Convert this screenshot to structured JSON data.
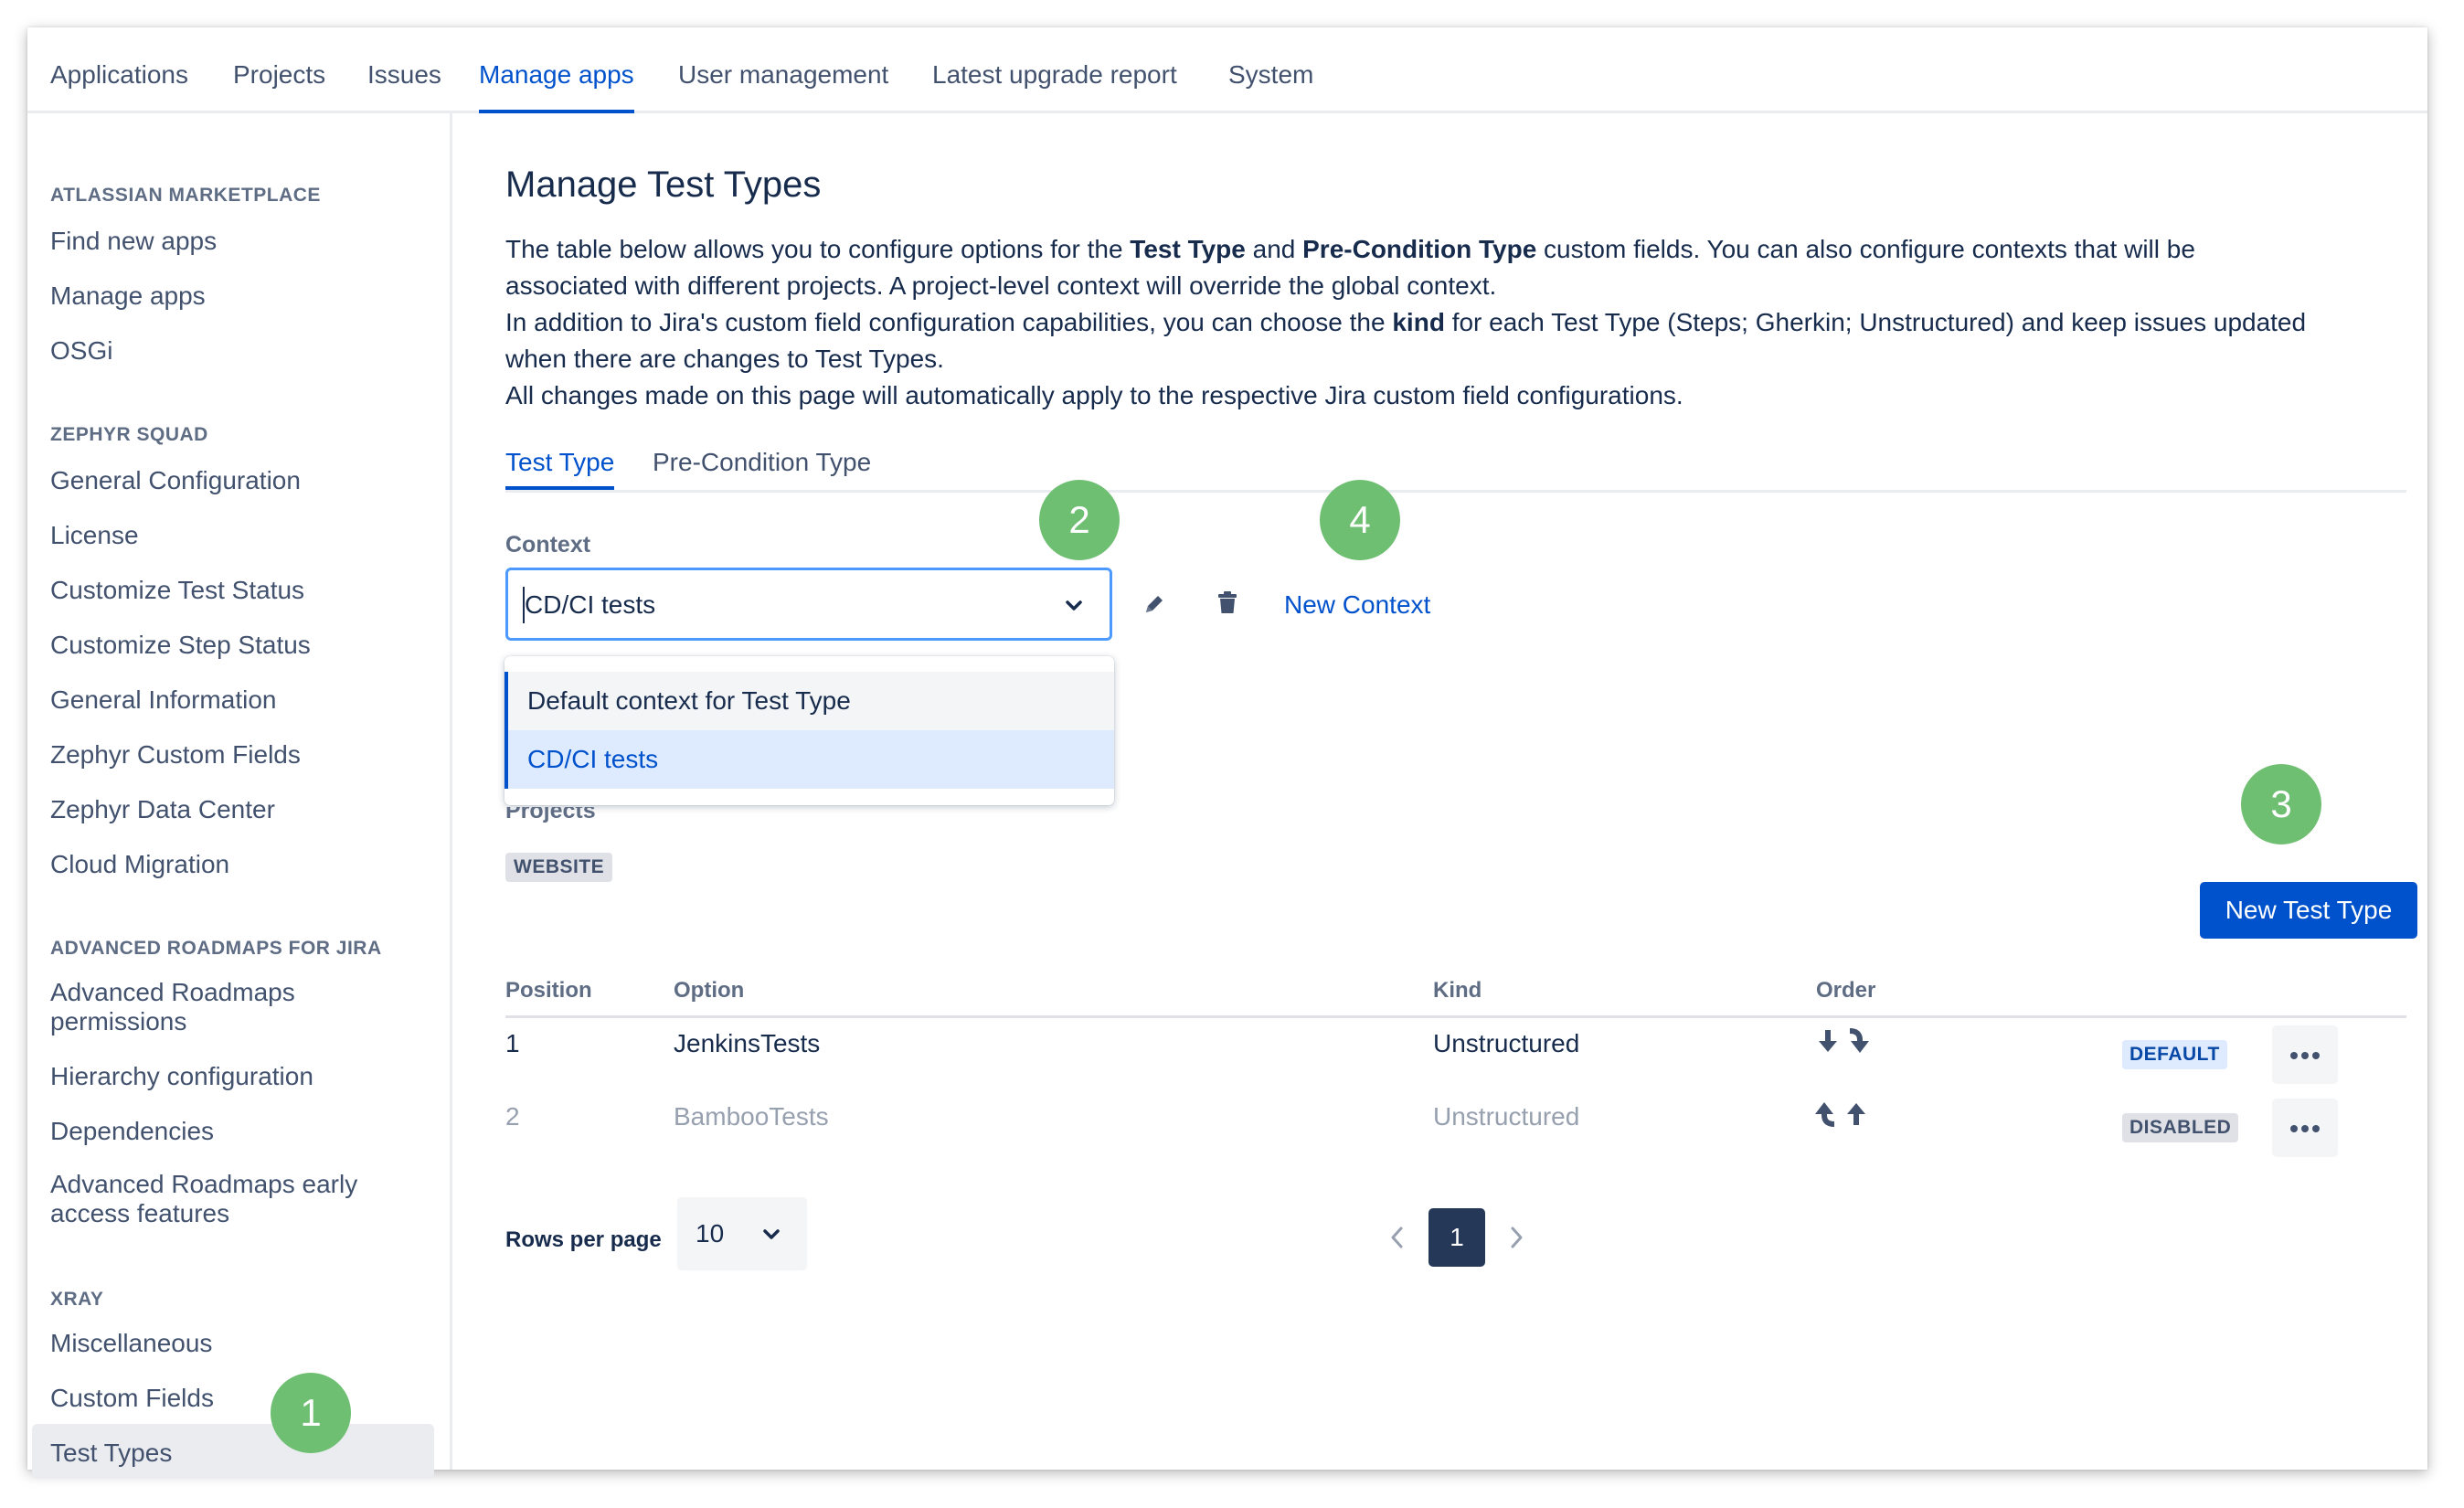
{
  "topnav": {
    "tabs": [
      {
        "label": "Applications"
      },
      {
        "label": "Projects"
      },
      {
        "label": "Issues"
      },
      {
        "label": "Manage apps"
      },
      {
        "label": "User management"
      },
      {
        "label": "Latest upgrade report"
      },
      {
        "label": "System"
      }
    ],
    "active": "Manage apps"
  },
  "sidebar": {
    "sections": [
      {
        "heading": "ATLASSIAN MARKETPLACE",
        "items": [
          "Find new apps",
          "Manage apps",
          "OSGi"
        ]
      },
      {
        "heading": "ZEPHYR SQUAD",
        "items": [
          "General Configuration",
          "License",
          "Customize Test Status",
          "Customize Step Status",
          "General Information",
          "Zephyr Custom Fields",
          "Zephyr Data Center",
          "Cloud Migration"
        ]
      },
      {
        "heading": "ADVANCED ROADMAPS FOR JIRA",
        "items": [
          "Advanced Roadmaps permissions",
          "Hierarchy configuration",
          "Dependencies",
          "Advanced Roadmaps early access features"
        ]
      },
      {
        "heading": "XRAY",
        "items": [
          "Miscellaneous",
          "Custom Fields",
          "Test Types"
        ]
      }
    ],
    "active": "Test Types"
  },
  "main": {
    "title": "Manage Test Types",
    "desc": {
      "l1_a": "The table below allows you to configure options for the ",
      "l1_b": "Test Type",
      "l1_c": " and ",
      "l1_d": "Pre-Condition Type",
      "l1_e": " custom fields. You can also configure contexts that will be",
      "l2": "associated with different projects. A project-level context will override the global context.",
      "l3_a": "In addition to Jira's custom field configuration capabilities, you can choose the ",
      "l3_b": "kind",
      "l3_c": " for each Test Type (Steps; Gherkin; Unstructured) and keep issues updated",
      "l4": "when there are changes to Test Types.",
      "l5": "All changes made on this page will automatically apply to the respective Jira custom field configurations."
    },
    "tabs": {
      "test_type": "Test Type",
      "precondition_type": "Pre-Condition Type"
    },
    "context": {
      "label": "Context",
      "value": "CD/CI tests",
      "new_context": "New Context",
      "options": [
        "Default context for Test Type",
        "CD/CI tests"
      ]
    },
    "projects": {
      "label": "Projects",
      "tag": "WEBSITE"
    },
    "new_test_type": "New Test Type",
    "table": {
      "headers": {
        "position": "Position",
        "option": "Option",
        "kind": "Kind",
        "order": "Order"
      },
      "rows": [
        {
          "position": "1",
          "option": "JenkinsTests",
          "kind": "Unstructured",
          "status": "DEFAULT"
        },
        {
          "position": "2",
          "option": "BambooTests",
          "kind": "Unstructured",
          "status": "DISABLED"
        }
      ]
    },
    "pagination": {
      "rows_per_page_label": "Rows per page",
      "rows_per_page": "10",
      "current_page": "1"
    }
  },
  "badges": [
    "1",
    "2",
    "3",
    "4"
  ],
  "colors": {
    "accent": "#0052cc",
    "badge": "#6fbf73",
    "dropdown_selected": "#deebff"
  },
  "icons": [
    "chevron-down-icon",
    "pencil-icon",
    "trash-icon",
    "arrow-down-icon",
    "arrow-up-icon",
    "more-icon",
    "chevron-left-icon",
    "chevron-right-icon"
  ]
}
